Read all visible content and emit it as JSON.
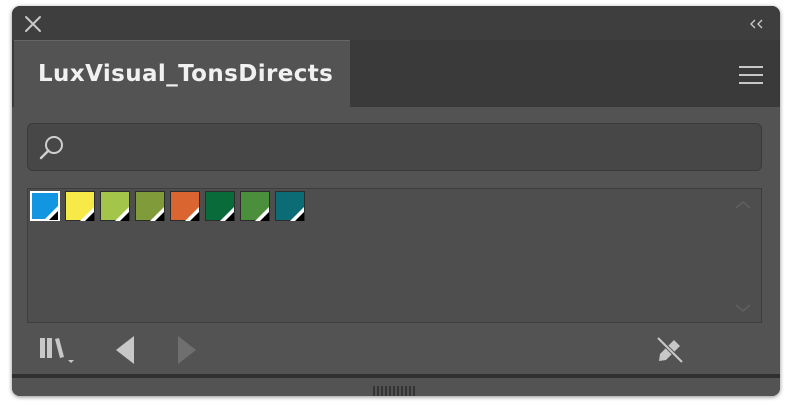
{
  "panel": {
    "tab_label": "LuxVisual_TonsDirects",
    "icons": {
      "close": "close-icon",
      "collapse": "double-chevron-left-icon",
      "menu": "hamburger-menu-icon",
      "search": "search-icon",
      "libraries": "libraries-icon",
      "previous": "triangle-left-icon",
      "next": "triangle-right-icon",
      "edit": "pencil-crossed-icon"
    }
  },
  "search": {
    "value": "",
    "placeholder": ""
  },
  "swatches": [
    {
      "color": "#1296e2",
      "selected": true
    },
    {
      "color": "#f7ea48",
      "selected": false
    },
    {
      "color": "#a3c64a",
      "selected": false
    },
    {
      "color": "#7f9b3a",
      "selected": false
    },
    {
      "color": "#db6530",
      "selected": false
    },
    {
      "color": "#0a6b3a",
      "selected": false
    },
    {
      "color": "#4b8f3c",
      "selected": false
    },
    {
      "color": "#0b6c75",
      "selected": false
    }
  ],
  "colors": {
    "panel_bg": "#535353",
    "topbar_bg": "#3e3e3e",
    "text": "#f1f1f1",
    "icon": "#c8c8c8",
    "icon_disabled": "#6f6f6f"
  }
}
